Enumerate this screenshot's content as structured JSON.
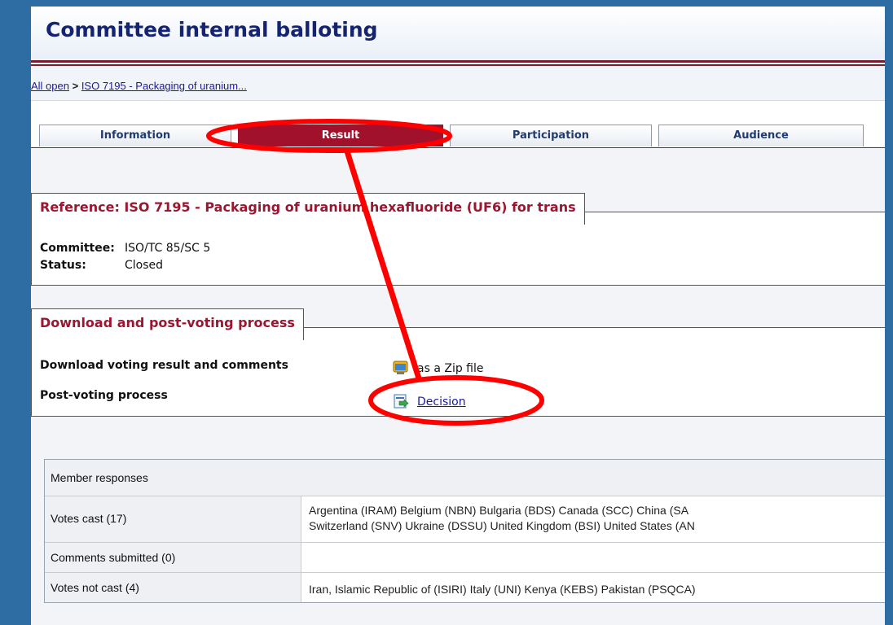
{
  "title": "Committee internal balloting",
  "breadcrumb": {
    "all_open": "All open",
    "sep": " > ",
    "current": "ISO 7195 - Packaging of uranium..."
  },
  "tabs": [
    {
      "label": "Information",
      "active": false
    },
    {
      "label": "Result",
      "active": true
    },
    {
      "label": "Participation",
      "active": false
    },
    {
      "label": "Audience",
      "active": false
    }
  ],
  "reference": {
    "legend": "Reference: ISO 7195 - Packaging of uranium hexafluoride (UF6) for trans",
    "committee_label": "Committee:",
    "committee_value": "ISO/TC 85/SC 5",
    "status_label": "Status:",
    "status_value": "Closed"
  },
  "download": {
    "legend": "Download and post-voting process",
    "download_label": "Download voting result and comments",
    "zip_icon": "folder-zip-icon",
    "zip_link": "as a Zip file",
    "post_label": "Post-voting process",
    "decision_icon": "document-arrow-icon",
    "decision_link": "Decision"
  },
  "member_responses": {
    "header": "Member responses",
    "votes_cast_label": "Votes cast (17)",
    "votes_cast_line1": "Argentina (IRAM)   Belgium (NBN)   Bulgaria (BDS)   Canada (SCC)   China (SA",
    "votes_cast_line2": "Switzerland (SNV)   Ukraine (DSSU)   United Kingdom (BSI)   United States (AN",
    "comments_label": "Comments submitted (0)",
    "not_cast_label": "Votes not cast (4)",
    "not_cast_value": "Iran, Islamic Republic of (ISIRI)   Italy (UNI)   Kenya (KEBS)   Pakistan (PSQCA)"
  },
  "colors": {
    "accent": "#a2112c",
    "title": "#152470",
    "annotation": "#ff0000",
    "background": "#2e6da4"
  }
}
